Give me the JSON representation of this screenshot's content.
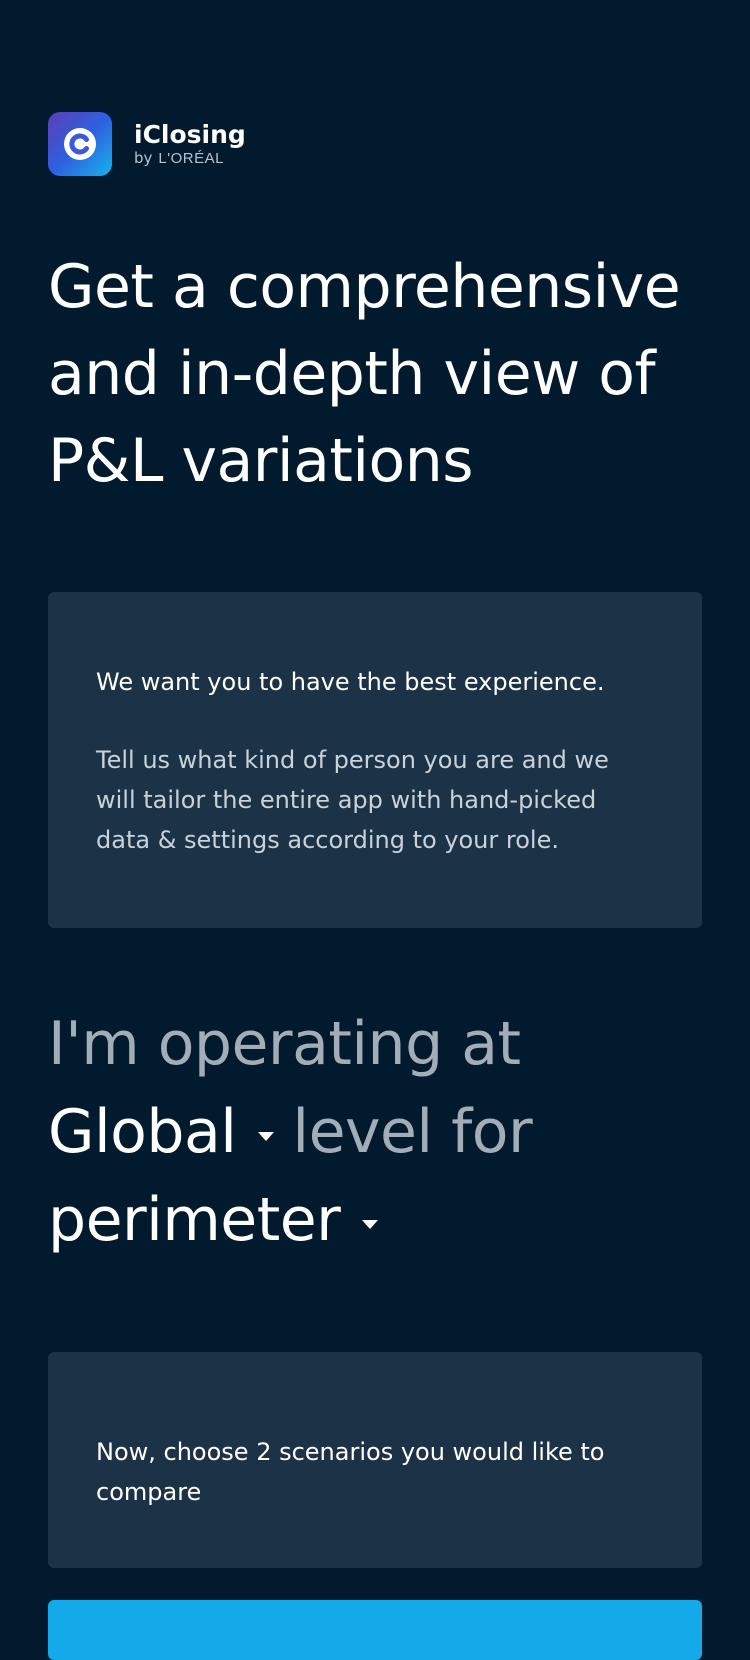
{
  "brand": {
    "name": "iClosing",
    "by": "by",
    "company": "L'ORÉAL",
    "logo_icon": "c-logo-icon"
  },
  "headline": "Get a comprehensive and in-depth view of P&L variations",
  "intro_card": {
    "lead": "We want you to have the best experience.",
    "body": "Tell us what kind of person you are and we will tailor the entire app with hand-picked data & settings according to your role."
  },
  "selector": {
    "prefix": "I'm operating at",
    "level_value": "Global",
    "middle": "level for",
    "perimeter_value": "perimeter"
  },
  "compare_card": {
    "text": "Now, choose 2 scenarios you would like to compare"
  },
  "colors": {
    "background": "#021a2e",
    "card": "#1c3347",
    "accent": "#14a9e8"
  }
}
